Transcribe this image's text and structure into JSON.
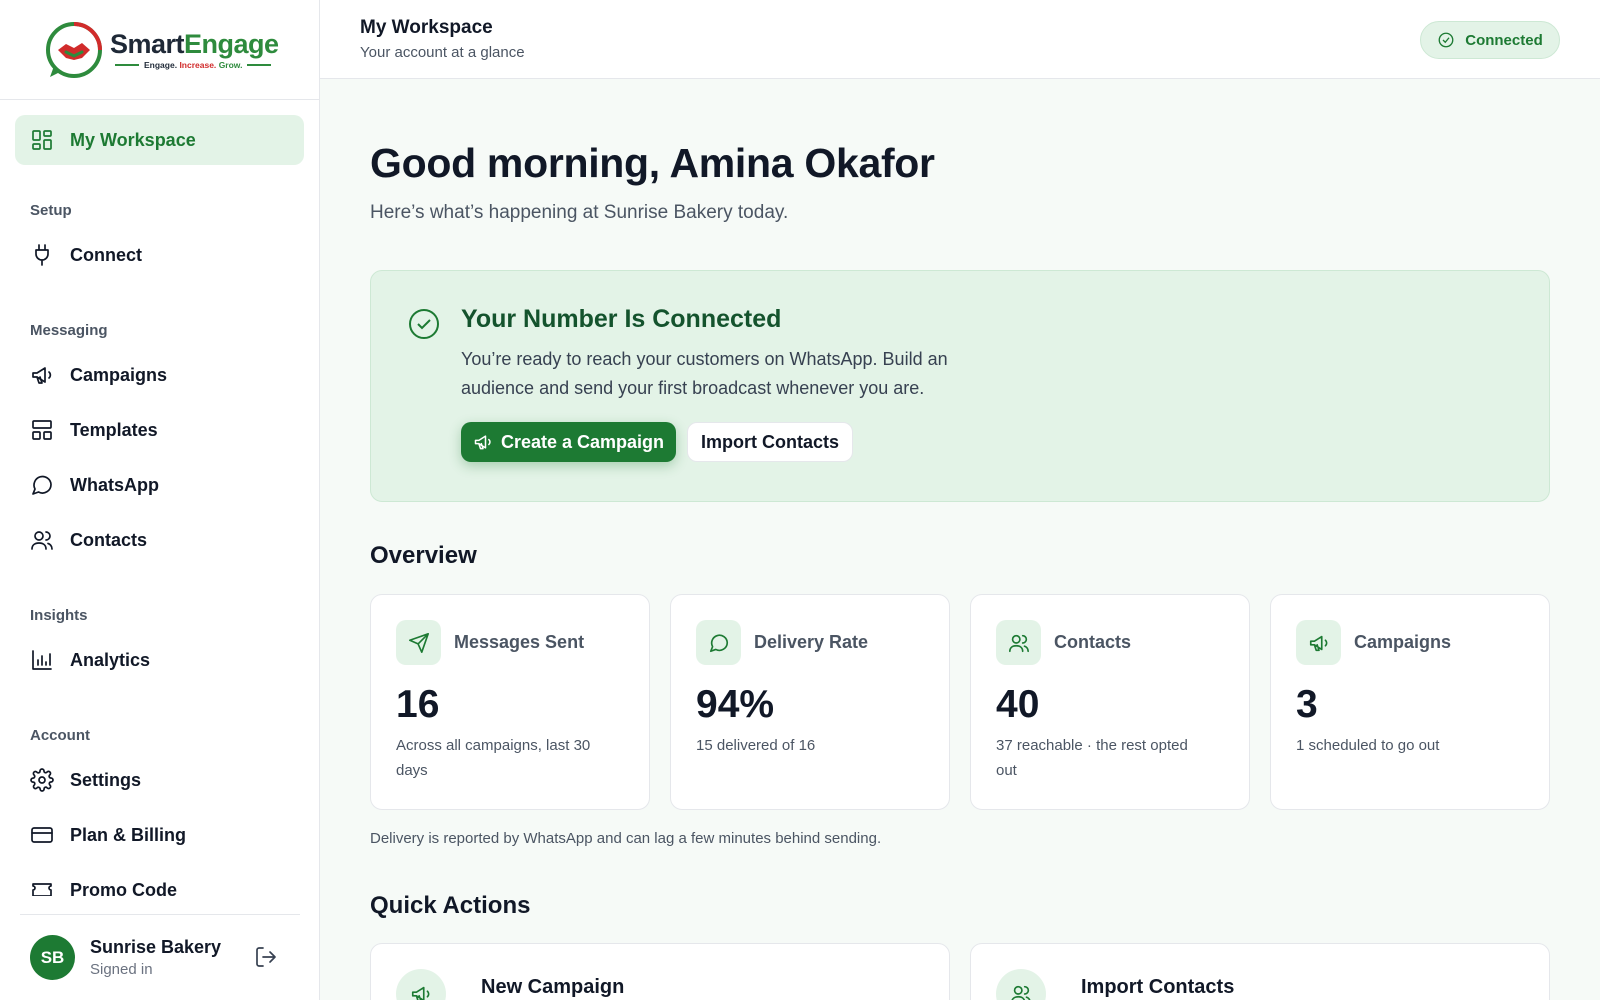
{
  "brand": {
    "name_part1": "Smart",
    "name_part2": "Engage",
    "tagline_1": "Engage.",
    "tagline_2": "Increase.",
    "tagline_3": "Grow.",
    "colors": {
      "green": "#2e8b3d",
      "red": "#d12b2b"
    }
  },
  "sidebar": {
    "active_item": {
      "label": "My Workspace",
      "icon": "grid-icon"
    },
    "sections": [
      {
        "title": "Setup",
        "items": [
          {
            "label": "Connect",
            "icon": "plug-icon"
          }
        ]
      },
      {
        "title": "Messaging",
        "items": [
          {
            "label": "Campaigns",
            "icon": "megaphone-icon"
          },
          {
            "label": "Templates",
            "icon": "layout-icon"
          },
          {
            "label": "WhatsApp",
            "icon": "chat-bubble-icon"
          },
          {
            "label": "Contacts",
            "icon": "users-icon"
          }
        ]
      },
      {
        "title": "Insights",
        "items": [
          {
            "label": "Analytics",
            "icon": "bar-chart-icon"
          }
        ]
      },
      {
        "title": "Account",
        "items": [
          {
            "label": "Settings",
            "icon": "gear-icon"
          },
          {
            "label": "Plan & Billing",
            "icon": "credit-card-icon"
          },
          {
            "label": "Promo Code",
            "icon": "ticket-icon"
          }
        ]
      }
    ],
    "user": {
      "initials": "SB",
      "name": "Sunrise Bakery",
      "status": "Signed in"
    }
  },
  "header": {
    "title": "My Workspace",
    "subtitle": "Your account at a glance",
    "status_badge": "Connected"
  },
  "main": {
    "greeting": "Good morning, Amina Okafor",
    "greeting_sub": "Here’s what’s happening at Sunrise Bakery today.",
    "banner": {
      "title": "Your Number Is Connected",
      "text": "You’re ready to reach your customers on WhatsApp. Build an audience and send your first broadcast whenever you are.",
      "primary_button": "Create a Campaign",
      "secondary_button": "Import Contacts"
    },
    "overview": {
      "title": "Overview",
      "stats": [
        {
          "label": "Messages Sent",
          "value": "16",
          "note": "Across all campaigns, last 30 days",
          "icon": "send-icon"
        },
        {
          "label": "Delivery Rate",
          "value": "94%",
          "note": "15 delivered of 16",
          "icon": "chat-bubble-icon"
        },
        {
          "label": "Contacts",
          "value": "40",
          "note": "37 reachable · the rest opted out",
          "icon": "users-icon"
        },
        {
          "label": "Campaigns",
          "value": "3",
          "note": "1 scheduled to go out",
          "icon": "megaphone-icon"
        }
      ],
      "footnote": "Delivery is reported by WhatsApp and can lag a few minutes behind sending."
    },
    "quick_actions": {
      "title": "Quick Actions",
      "items": [
        {
          "label": "New Campaign",
          "icon": "megaphone-icon"
        },
        {
          "label": "Import Contacts",
          "icon": "users-icon"
        }
      ]
    }
  }
}
